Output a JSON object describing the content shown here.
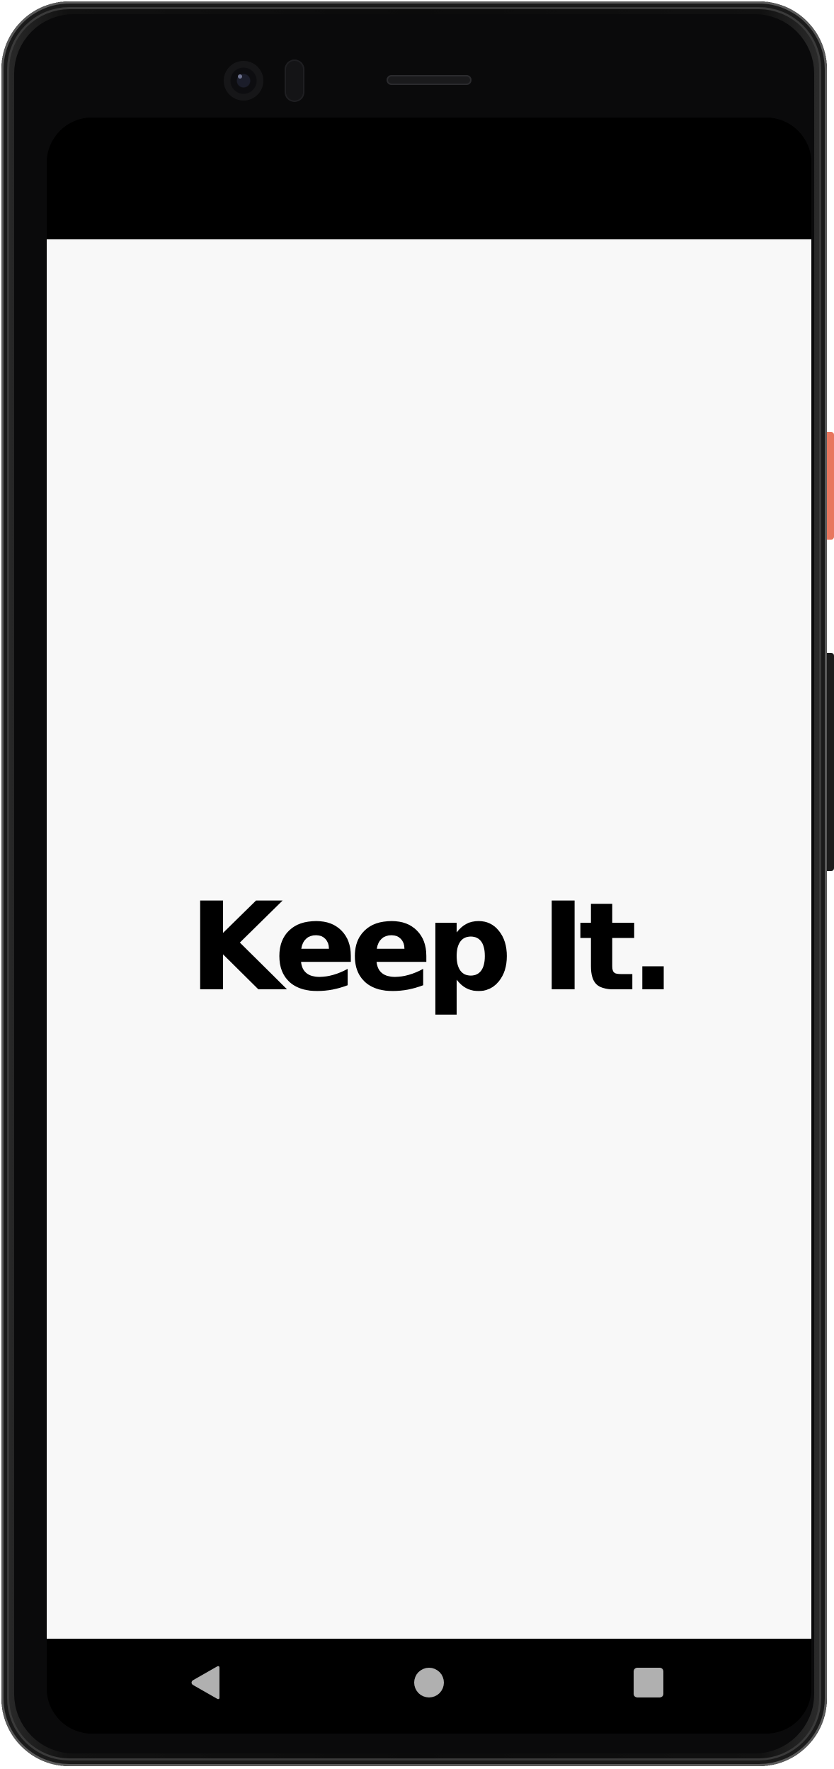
{
  "app": {
    "splash_title": "Keep It."
  },
  "colors": {
    "screen_background": "#f8f8f8",
    "title_color": "#000000",
    "nav_icon_color": "#b0b0b0",
    "device_accent_key": "#e8765e"
  },
  "navigation_bar": {
    "icons": [
      "back-icon",
      "home-icon",
      "recents-icon"
    ]
  }
}
